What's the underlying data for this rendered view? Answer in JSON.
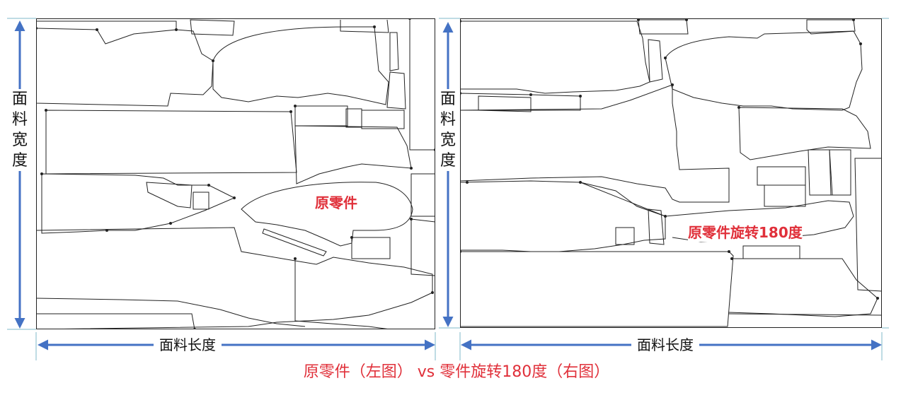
{
  "left": {
    "width_label": "面料宽度",
    "length_label": "面料长度",
    "annotation": "原零件"
  },
  "right": {
    "width_label": "面料宽度",
    "length_label": "面料长度",
    "annotation": "原零件旋转180度"
  },
  "caption": "原零件（左图） vs 零件旋转180度（右图）",
  "colors": {
    "arrow": "#4472c4",
    "annotation": "#e0303a",
    "outline": "#222222"
  }
}
